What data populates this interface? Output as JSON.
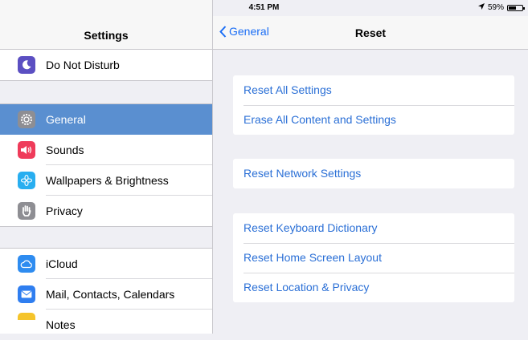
{
  "status_bar": {
    "device": "iPad",
    "time": "4:51 PM",
    "battery": "59%",
    "battery_level": 0.59
  },
  "sidebar": {
    "title": "Settings",
    "items": [
      {
        "label": "Do Not Disturb",
        "icon": "moon-icon",
        "color": "#5b4fc2"
      },
      {
        "label": "General",
        "icon": "gear-icon",
        "color": "#8e8e93",
        "selected": true
      },
      {
        "label": "Sounds",
        "icon": "speaker-icon",
        "color": "#ef3b5a"
      },
      {
        "label": "Wallpapers & Brightness",
        "icon": "flower-icon",
        "color": "#28aef0"
      },
      {
        "label": "Privacy",
        "icon": "hand-icon",
        "color": "#8e8e93"
      },
      {
        "label": "iCloud",
        "icon": "cloud-icon",
        "color": "#2e8cf0"
      },
      {
        "label": "Mail, Contacts, Calendars",
        "icon": "envelope-icon",
        "color": "#2f7ef0"
      },
      {
        "label": "Notes",
        "icon": "notes-icon",
        "color": "#f5c42b"
      }
    ]
  },
  "navbar": {
    "back_label": "General",
    "title": "Reset"
  },
  "reset_groups": [
    [
      "Reset All Settings",
      "Erase All Content and Settings"
    ],
    [
      "Reset Network Settings"
    ],
    [
      "Reset Keyboard Dictionary",
      "Reset Home Screen Layout",
      "Reset Location & Privacy"
    ]
  ],
  "colors": {
    "accent": "#1b6ef5",
    "selected_row": "#5a8fd0",
    "background": "#efeff4"
  }
}
